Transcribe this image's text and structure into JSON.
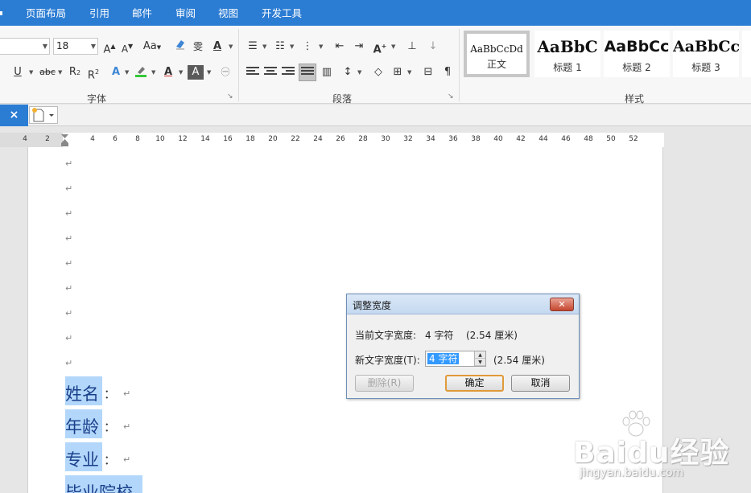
{
  "menubar": {
    "items": [
      "页面布局",
      "引用",
      "邮件",
      "审阅",
      "视图",
      "开发工具"
    ]
  },
  "ribbon": {
    "font_size": "18",
    "groups": {
      "font": "字体",
      "paragraph": "段落",
      "styles": "样式"
    },
    "styles": [
      {
        "preview": "AaBbCcDd",
        "name": "正文"
      },
      {
        "preview": "AaBbC",
        "name": "标题 1"
      },
      {
        "preview": "AaBbCc",
        "name": "标题 2"
      },
      {
        "preview": "AaBbCc",
        "name": "标题 3"
      }
    ]
  },
  "tabbar": {
    "close_glyph": "×"
  },
  "ruler": {
    "numbers": [
      "4",
      "2",
      "2",
      "4",
      "6",
      "8",
      "10",
      "12",
      "14",
      "16",
      "18",
      "20",
      "22",
      "24",
      "26",
      "28",
      "30",
      "32",
      "34",
      "36",
      "38",
      "40",
      "42",
      "44",
      "46",
      "48",
      "50",
      "52"
    ]
  },
  "document": {
    "para_mark": "↵",
    "fields": [
      "姓名",
      "年龄",
      "专业",
      "毕业院校"
    ],
    "colon": "："
  },
  "dialog": {
    "title": "调整宽度",
    "close_glyph": "✕",
    "current_label": "当前文字宽度:",
    "current_value": "4  字符",
    "current_cm": "(2.54 厘米)",
    "new_label": "新文字宽度(T):",
    "new_value": "4 字符",
    "new_cm": "(2.54 厘米)",
    "delete_button": "删除(R)",
    "ok_button": "确定",
    "cancel_button": "取消"
  },
  "watermark": {
    "brand": "Baidu经验",
    "url": "jingyan.baidu.com"
  },
  "colors": {
    "accent": "#2b7cd3",
    "selection": "#b2d7fb",
    "dialog_focus": "#e09a3a"
  }
}
